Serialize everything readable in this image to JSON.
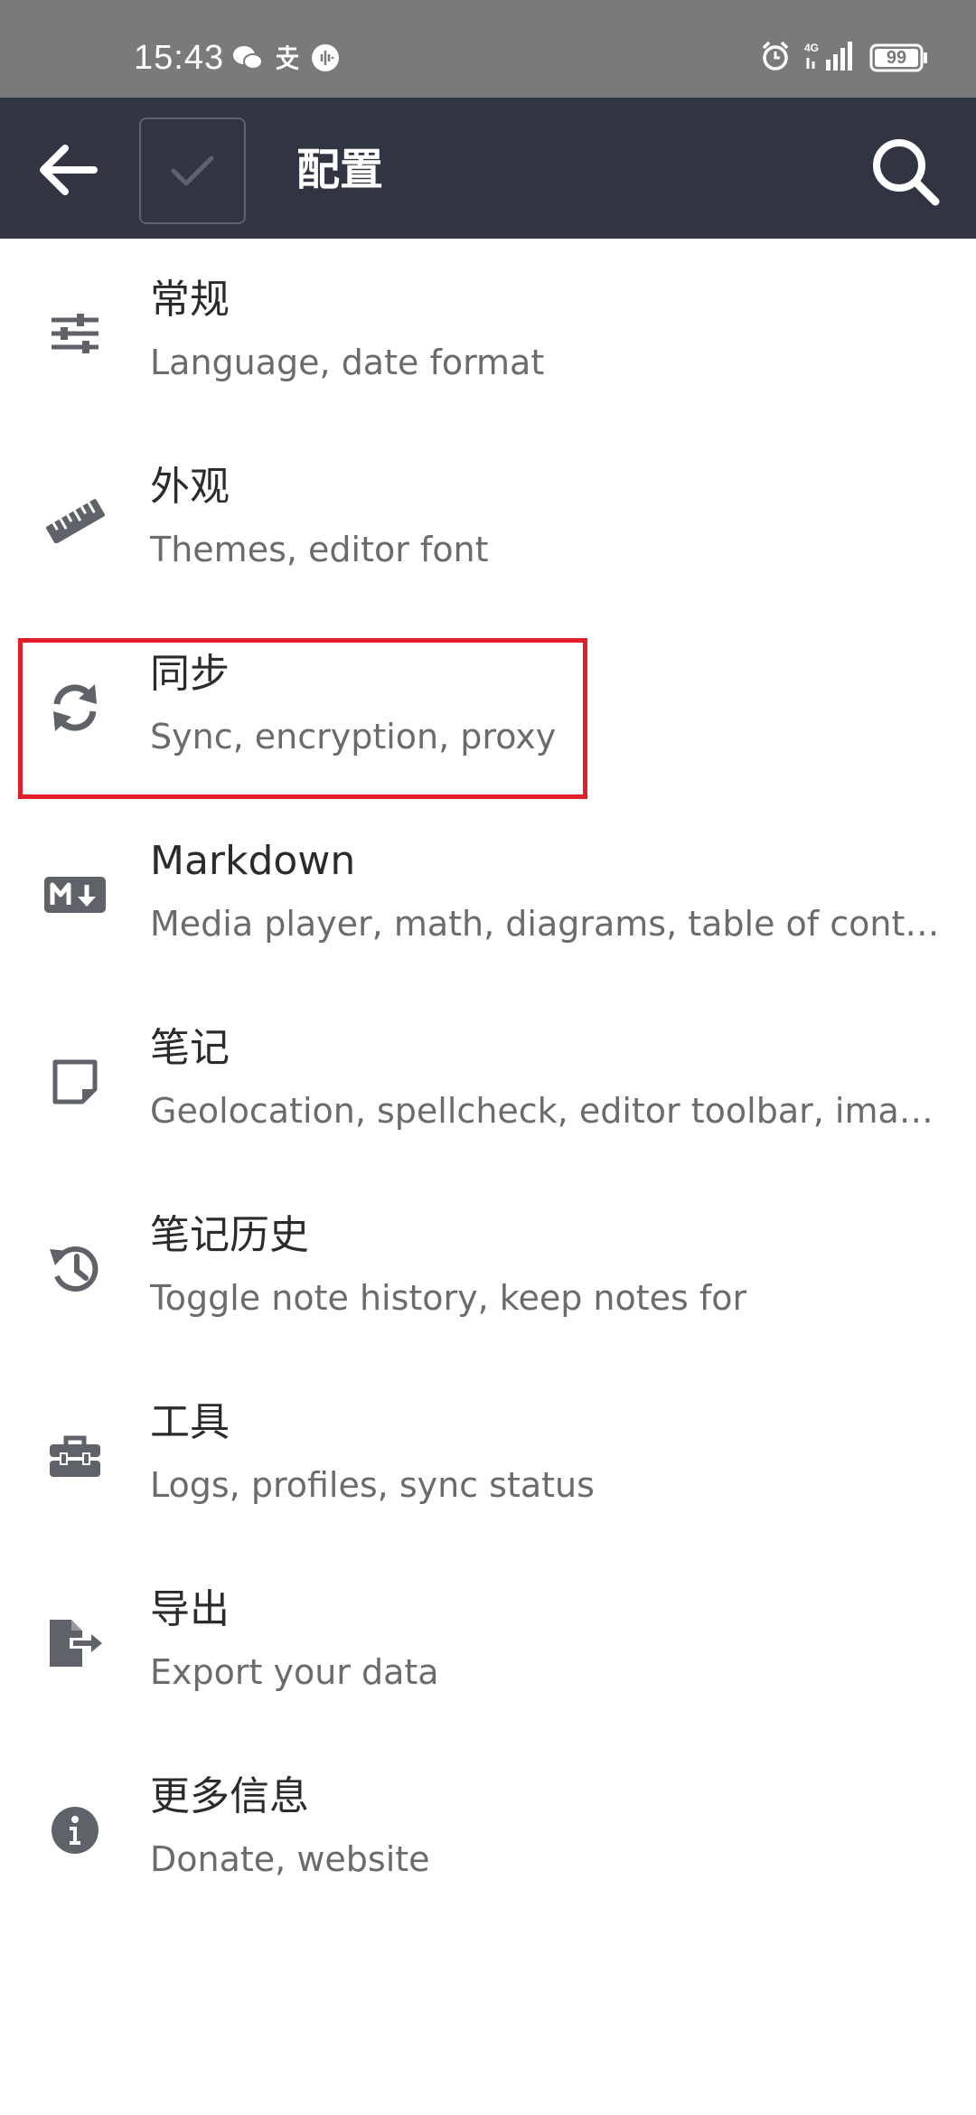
{
  "status": {
    "time": "15:43",
    "battery": "99",
    "network": "4G"
  },
  "app_bar": {
    "title": "配置"
  },
  "colors": {
    "status_bg": "#7a7a7a",
    "app_bar_bg": "#313543",
    "icon": "#5f6268",
    "title_text": "#2b2b2b",
    "subtitle_text": "#6b6b6b",
    "highlight": "#e21e2b"
  },
  "items": [
    {
      "title": "常规",
      "subtitle": "Language, date format",
      "icon": "sliders-icon"
    },
    {
      "title": "外观",
      "subtitle": "Themes, editor font",
      "icon": "ruler-icon"
    },
    {
      "title": "同步",
      "subtitle": "Sync, encryption, proxy",
      "icon": "sync-icon"
    },
    {
      "title": "Markdown",
      "subtitle": "Media player, math, diagrams, table of contents",
      "icon": "markdown-icon"
    },
    {
      "title": "笔记",
      "subtitle": "Geolocation, spellcheck, editor toolbar, image resize",
      "icon": "note-icon"
    },
    {
      "title": "笔记历史",
      "subtitle": "Toggle note history, keep notes for",
      "icon": "history-icon"
    },
    {
      "title": "工具",
      "subtitle": "Logs, profiles, sync status",
      "icon": "toolbox-icon"
    },
    {
      "title": "导出",
      "subtitle": "Export your data",
      "icon": "export-icon"
    },
    {
      "title": "更多信息",
      "subtitle": "Donate, website",
      "icon": "info-icon"
    }
  ]
}
